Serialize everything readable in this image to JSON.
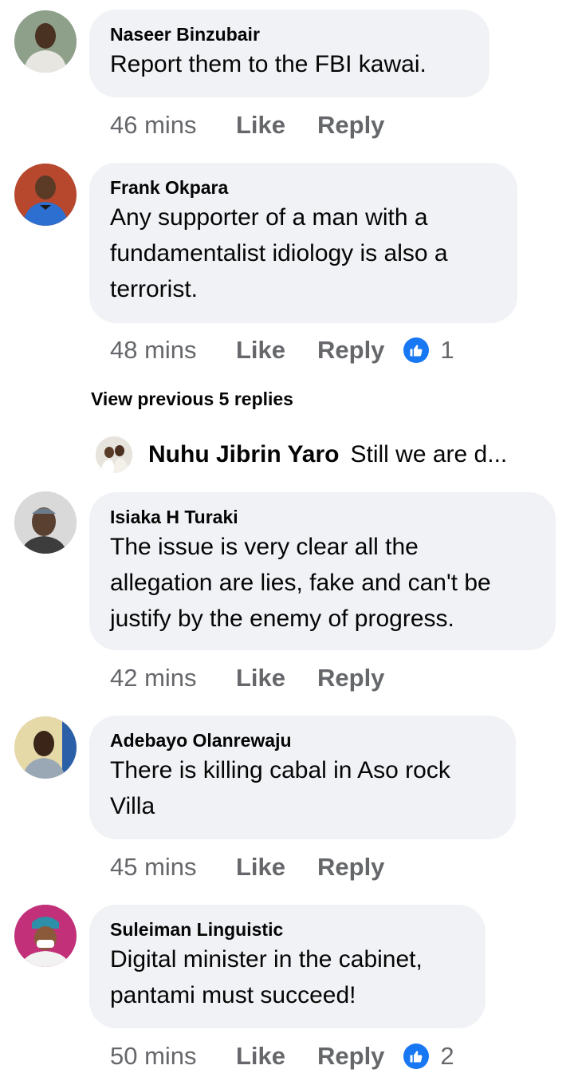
{
  "comments": [
    {
      "author": "Naseer Binzubair",
      "text_lines": [
        "Report them to the FBI kawai."
      ],
      "time": "46 mins",
      "like": "Like",
      "reply": "Reply"
    },
    {
      "author": "Frank Okpara",
      "text_lines": [
        "Any supporter of a man with a",
        "fundamentalist idiology is also a",
        "terrorist."
      ],
      "time": "48 mins",
      "like": "Like",
      "reply": "Reply",
      "reactions": "1"
    },
    {
      "author": "Isiaka H Turaki",
      "text_lines": [
        "The issue is very clear all the",
        "allegation are lies, fake and can't be",
        "justify by the enemy of progress."
      ],
      "time": "42 mins",
      "like": "Like",
      "reply": "Reply"
    },
    {
      "author": "Adebayo Olanrewaju",
      "text_lines": [
        "There is killing cabal in Aso rock",
        "Villa"
      ],
      "time": "45 mins",
      "like": "Like",
      "reply": "Reply"
    },
    {
      "author": "Suleiman Linguistic",
      "text_lines": [
        "Digital minister in the cabinet,",
        "pantami must succeed!"
      ],
      "time": "50 mins",
      "like": "Like",
      "reply": "Reply",
      "reactions": "2"
    }
  ],
  "view_previous": "View previous 5 replies",
  "reply_preview": {
    "author": "Nuhu Jibrin Yaro",
    "text": "Still we are d..."
  },
  "colors": {
    "bubble": "#f0f2f5",
    "meta": "#65676b",
    "like_reaction": "#1877f2"
  },
  "icons": {
    "reaction": "like-reaction-icon",
    "avatar": "avatar"
  }
}
